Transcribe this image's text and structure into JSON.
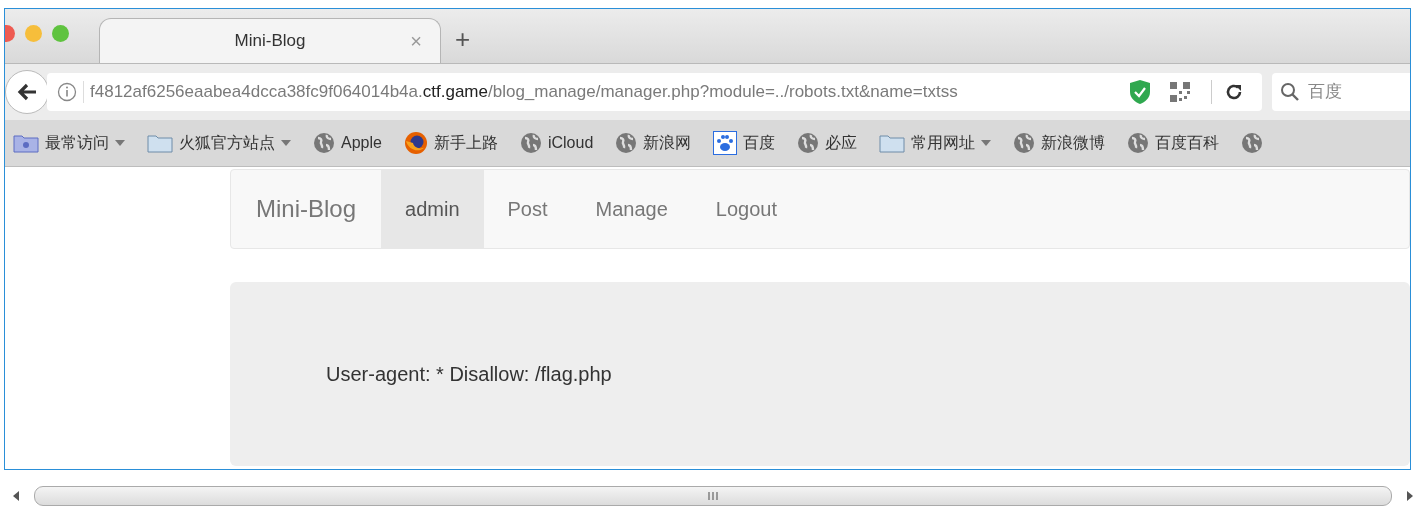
{
  "tab": {
    "title": "Mini-Blog",
    "close": "×",
    "new_tab": "+"
  },
  "address_bar": {
    "url_start": "f4812af6256eaabea4dcca38fc9f064014b4a.",
    "url_host": "ctf.game",
    "url_path": "/blog_manage/manager.php?module=../robots.txt&name=txtss"
  },
  "search": {
    "placeholder": "百度"
  },
  "bookmarks": [
    {
      "kind": "special-folder",
      "label": "最常访问",
      "dropdown": true
    },
    {
      "kind": "folder",
      "label": "火狐官方站点",
      "dropdown": true
    },
    {
      "kind": "globe",
      "label": "Apple",
      "dropdown": false
    },
    {
      "kind": "firefox",
      "label": "新手上路",
      "dropdown": false
    },
    {
      "kind": "globe",
      "label": "iCloud",
      "dropdown": false
    },
    {
      "kind": "globe",
      "label": "新浪网",
      "dropdown": false
    },
    {
      "kind": "paw",
      "label": "百度",
      "dropdown": false
    },
    {
      "kind": "globe",
      "label": "必应",
      "dropdown": false
    },
    {
      "kind": "folder",
      "label": "常用网址",
      "dropdown": true
    },
    {
      "kind": "globe",
      "label": "新浪微博",
      "dropdown": false
    },
    {
      "kind": "globe",
      "label": "百度百科",
      "dropdown": false
    },
    {
      "kind": "globe"
    }
  ],
  "navbar": {
    "brand": "Mini-Blog",
    "items": [
      {
        "label": "admin",
        "selected": true
      },
      {
        "label": "Post",
        "selected": false
      },
      {
        "label": "Manage",
        "selected": false
      },
      {
        "label": "Logout",
        "selected": false
      }
    ]
  },
  "content": {
    "text": "User-agent: * Disallow: /flag.php"
  }
}
